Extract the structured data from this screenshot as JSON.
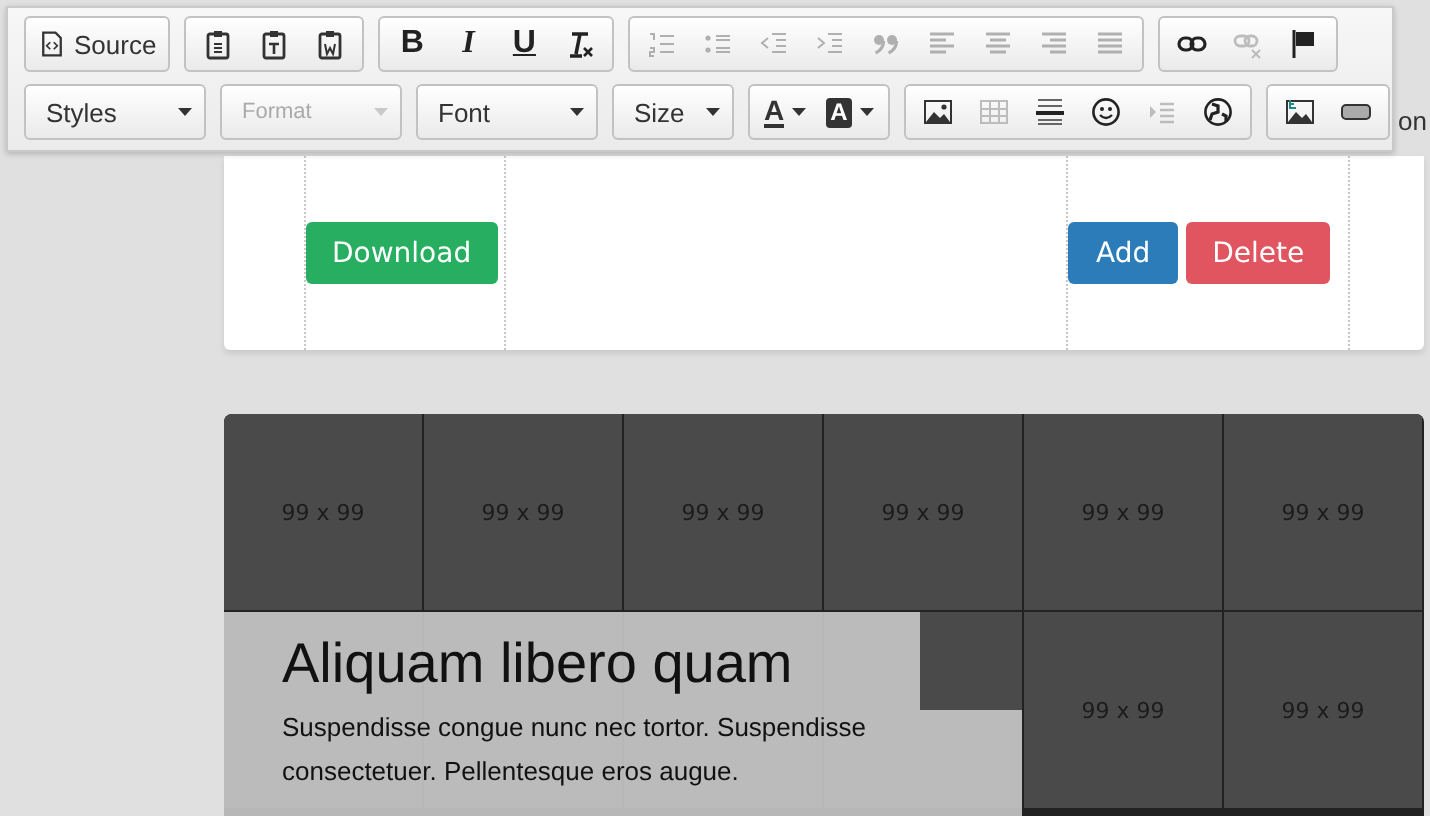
{
  "toolbar": {
    "rows": [
      [
        {
          "items": [
            {
              "kind": "source",
              "label": "Source",
              "disabled": false
            }
          ]
        },
        {
          "items": [
            {
              "kind": "paste",
              "disabled": false
            },
            {
              "kind": "paste-text",
              "disabled": false
            },
            {
              "kind": "paste-word",
              "disabled": false
            }
          ]
        },
        {
          "items": [
            {
              "kind": "bold",
              "label": "B",
              "disabled": false
            },
            {
              "kind": "italic",
              "label": "I",
              "disabled": false
            },
            {
              "kind": "underline",
              "label": "U",
              "disabled": false
            },
            {
              "kind": "clear-format",
              "disabled": false
            }
          ]
        },
        {
          "items": [
            {
              "kind": "numbered-list",
              "disabled": true
            },
            {
              "kind": "bulleted-list",
              "disabled": true
            },
            {
              "kind": "outdent",
              "disabled": true
            },
            {
              "kind": "indent",
              "disabled": true
            },
            {
              "kind": "quote",
              "disabled": true
            },
            {
              "kind": "align-left",
              "disabled": true
            },
            {
              "kind": "align-center",
              "disabled": true
            },
            {
              "kind": "align-right",
              "disabled": true
            },
            {
              "kind": "justify",
              "disabled": true
            }
          ]
        },
        {
          "items": [
            {
              "kind": "link",
              "disabled": false
            },
            {
              "kind": "unlink",
              "disabled": true
            },
            {
              "kind": "anchor",
              "disabled": false
            }
          ]
        }
      ],
      [
        {
          "items": [
            {
              "kind": "combo",
              "label": "Styles",
              "disabled": false
            }
          ]
        },
        {
          "items": [
            {
              "kind": "combo",
              "label": "Format",
              "disabled": true
            }
          ]
        },
        {
          "items": [
            {
              "kind": "combo",
              "label": "Font",
              "disabled": false
            }
          ]
        },
        {
          "items": [
            {
              "kind": "combo",
              "label": "Size",
              "disabled": false
            }
          ]
        },
        {
          "items": [
            {
              "kind": "text-color",
              "label": "A",
              "disabled": false
            },
            {
              "kind": "bg-color",
              "label": "A",
              "disabled": false
            }
          ]
        },
        {
          "items": [
            {
              "kind": "image",
              "disabled": false
            },
            {
              "kind": "table",
              "disabled": true
            },
            {
              "kind": "rule",
              "disabled": false
            },
            {
              "kind": "smiley",
              "disabled": false
            },
            {
              "kind": "blocks",
              "disabled": true
            },
            {
              "kind": "globe",
              "disabled": false
            }
          ]
        },
        {
          "items": [
            {
              "kind": "captioned-image",
              "disabled": false
            },
            {
              "kind": "widget",
              "disabled": false
            }
          ]
        }
      ]
    ]
  },
  "side_fragment": "on",
  "card": {
    "buttons": [
      {
        "label": "Download",
        "kind": "success"
      },
      {
        "label": "Add",
        "kind": "primary"
      },
      {
        "label": "Delete",
        "kind": "danger"
      }
    ]
  },
  "gallery": {
    "tiles": [
      {
        "kind": "labeled",
        "label": "99 x 99"
      },
      {
        "kind": "labeled",
        "label": "99 x 99"
      },
      {
        "kind": "labeled",
        "label": "99 x 99"
      },
      {
        "kind": "labeled",
        "label": "99 x 99"
      },
      {
        "kind": "labeled",
        "label": "99 x 99"
      },
      {
        "kind": "labeled",
        "label": "99 x 99"
      },
      {
        "kind": "blank"
      },
      {
        "kind": "blank"
      },
      {
        "kind": "blank"
      },
      {
        "kind": "blank"
      },
      {
        "kind": "labeled",
        "label": "99 x 99"
      },
      {
        "kind": "labeled",
        "label": "99 x 99"
      }
    ],
    "caption": {
      "title": "Aliquam libero quam",
      "text": "Suspendisse congue nunc nec tortor. Suspendisse consectetuer. Pellentesque eros augue."
    }
  }
}
